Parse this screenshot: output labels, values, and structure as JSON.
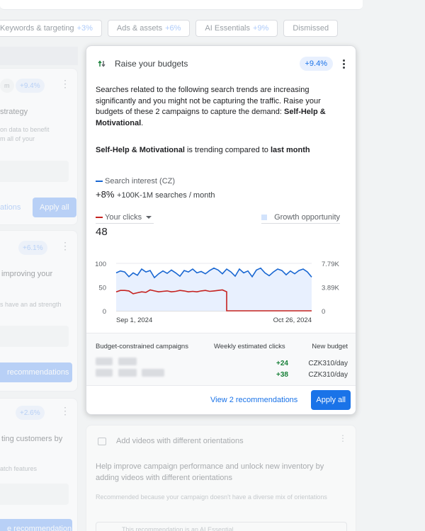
{
  "filter_chips": [
    {
      "label": "Keywords & targeting",
      "pct": "+3%"
    },
    {
      "label": "Ads & assets",
      "pct": "+6%"
    },
    {
      "label": "AI Essentials",
      "pct": "+9%"
    },
    {
      "label": "Dismissed",
      "pct": ""
    }
  ],
  "left_cards": [
    {
      "pill": "+9.4%",
      "label_top": "strategy",
      "small_1": "on data to benefit",
      "small_2": "m all of your",
      "link": "ations",
      "button": "Apply all"
    },
    {
      "pill": "+6.1%",
      "label_top": "improving your",
      "small_1": "s have an ad strength",
      "button": "recommendations"
    },
    {
      "pill": "+2.6%",
      "label_top": "ting customers by",
      "small_1": "atch features",
      "button": "e recommendation"
    }
  ],
  "main_card": {
    "title": "Raise your budgets",
    "badge": "+9.4%",
    "description_1": "Searches related to the following search trends are increasing significantly and you might not be capturing the traffic. Raise your budgets of these 2 campaigns to capture the demand: ",
    "description_trend": "Self-Help & Motivational",
    "trend_subject": "Self-Help & Motivational",
    "trend_mid": " is trending compared to ",
    "trend_period": "last month",
    "search_interest_label": "Search interest (CZ)",
    "search_interest_change": "+8%",
    "search_interest_range": "+100K-1M searches / month",
    "your_clicks_label": "Your clicks",
    "your_clicks_value": "48",
    "growth_label": "Growth opportunity",
    "table": {
      "headers": [
        "Budget-constrained campaigns",
        "Weekly estimated clicks",
        "New budget"
      ],
      "rows": [
        {
          "clicks": "+24",
          "budget": "CZK310/day"
        },
        {
          "clicks": "+38",
          "budget": "CZK310/day"
        }
      ]
    },
    "view_link": "View 2 recommendations",
    "apply_button": "Apply all"
  },
  "chart_data": {
    "type": "line",
    "x_labels": [
      "Sep 1, 2024",
      "Oct 26, 2024"
    ],
    "left_axis_ticks": [
      "100",
      "50",
      "0"
    ],
    "right_axis_ticks": [
      "7.79K",
      "3.89K",
      "0"
    ],
    "ylim": [
      0,
      100
    ],
    "series": [
      {
        "name": "Search interest (CZ)",
        "color": "#1967d2",
        "values": [
          80,
          84,
          82,
          72,
          80,
          75,
          88,
          82,
          85,
          70,
          78,
          84,
          79,
          86,
          80,
          73,
          85,
          82,
          88,
          80,
          83,
          78,
          85,
          90,
          86,
          78,
          88,
          82,
          73,
          88,
          80,
          84,
          72,
          86,
          90,
          80,
          74,
          82,
          88,
          85,
          76,
          84,
          78,
          85,
          88,
          82,
          71
        ]
      },
      {
        "name": "Your clicks",
        "color": "#c5221f",
        "values": [
          40,
          43,
          43,
          42,
          36,
          38,
          40,
          39,
          44,
          42,
          40,
          41,
          42,
          40,
          41,
          43,
          42,
          40,
          41,
          40,
          42,
          43,
          41,
          42,
          43,
          44,
          40,
          0,
          0,
          0,
          0,
          0,
          0,
          0,
          0,
          0,
          0,
          0,
          0,
          0,
          0,
          0,
          0,
          0,
          0,
          0,
          0
        ]
      }
    ],
    "area_color": "#e8f0fe",
    "grid": true
  },
  "bottom_card": {
    "title": "Add videos with different orientations",
    "text": "Help improve campaign performance and unlock new inventory by adding videos with different orientations",
    "small": "Recommended because your campaign doesn't have a diverse mix of orientations",
    "ai_note": "This recommendation is an AI Essential"
  }
}
